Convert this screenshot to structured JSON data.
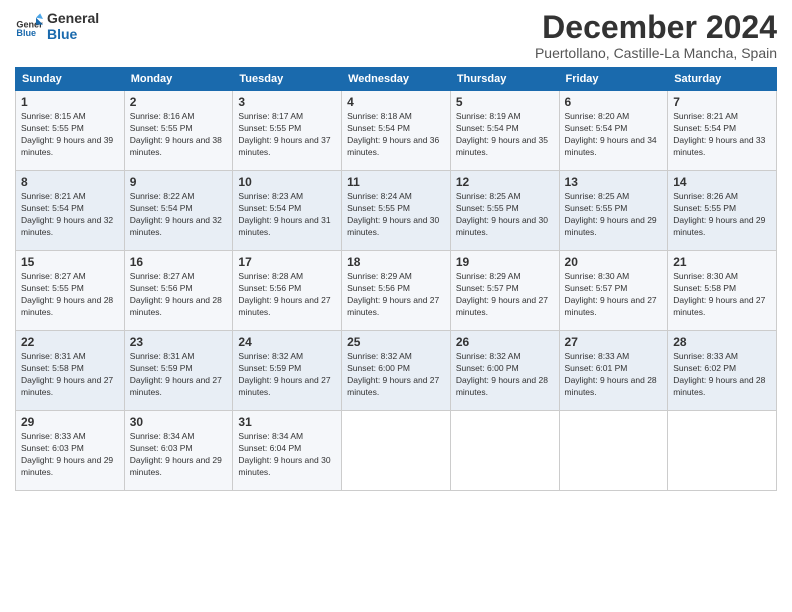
{
  "header": {
    "logo": {
      "general": "General",
      "blue": "Blue"
    },
    "title": "December 2024",
    "location": "Puertollano, Castille-La Mancha, Spain"
  },
  "calendar": {
    "days_of_week": [
      "Sunday",
      "Monday",
      "Tuesday",
      "Wednesday",
      "Thursday",
      "Friday",
      "Saturday"
    ],
    "weeks": [
      [
        null,
        null,
        null,
        null,
        null,
        null,
        null
      ]
    ],
    "cells": [
      {
        "day": 1,
        "sunrise": "8:15 AM",
        "sunset": "5:55 PM",
        "daylight": "9 hours and 39 minutes."
      },
      {
        "day": 2,
        "sunrise": "8:16 AM",
        "sunset": "5:55 PM",
        "daylight": "9 hours and 38 minutes."
      },
      {
        "day": 3,
        "sunrise": "8:17 AM",
        "sunset": "5:55 PM",
        "daylight": "9 hours and 37 minutes."
      },
      {
        "day": 4,
        "sunrise": "8:18 AM",
        "sunset": "5:54 PM",
        "daylight": "9 hours and 36 minutes."
      },
      {
        "day": 5,
        "sunrise": "8:19 AM",
        "sunset": "5:54 PM",
        "daylight": "9 hours and 35 minutes."
      },
      {
        "day": 6,
        "sunrise": "8:20 AM",
        "sunset": "5:54 PM",
        "daylight": "9 hours and 34 minutes."
      },
      {
        "day": 7,
        "sunrise": "8:21 AM",
        "sunset": "5:54 PM",
        "daylight": "9 hours and 33 minutes."
      },
      {
        "day": 8,
        "sunrise": "8:21 AM",
        "sunset": "5:54 PM",
        "daylight": "9 hours and 32 minutes."
      },
      {
        "day": 9,
        "sunrise": "8:22 AM",
        "sunset": "5:54 PM",
        "daylight": "9 hours and 32 minutes."
      },
      {
        "day": 10,
        "sunrise": "8:23 AM",
        "sunset": "5:54 PM",
        "daylight": "9 hours and 31 minutes."
      },
      {
        "day": 11,
        "sunrise": "8:24 AM",
        "sunset": "5:55 PM",
        "daylight": "9 hours and 30 minutes."
      },
      {
        "day": 12,
        "sunrise": "8:25 AM",
        "sunset": "5:55 PM",
        "daylight": "9 hours and 30 minutes."
      },
      {
        "day": 13,
        "sunrise": "8:25 AM",
        "sunset": "5:55 PM",
        "daylight": "9 hours and 29 minutes."
      },
      {
        "day": 14,
        "sunrise": "8:26 AM",
        "sunset": "5:55 PM",
        "daylight": "9 hours and 29 minutes."
      },
      {
        "day": 15,
        "sunrise": "8:27 AM",
        "sunset": "5:55 PM",
        "daylight": "9 hours and 28 minutes."
      },
      {
        "day": 16,
        "sunrise": "8:27 AM",
        "sunset": "5:56 PM",
        "daylight": "9 hours and 28 minutes."
      },
      {
        "day": 17,
        "sunrise": "8:28 AM",
        "sunset": "5:56 PM",
        "daylight": "9 hours and 27 minutes."
      },
      {
        "day": 18,
        "sunrise": "8:29 AM",
        "sunset": "5:56 PM",
        "daylight": "9 hours and 27 minutes."
      },
      {
        "day": 19,
        "sunrise": "8:29 AM",
        "sunset": "5:57 PM",
        "daylight": "9 hours and 27 minutes."
      },
      {
        "day": 20,
        "sunrise": "8:30 AM",
        "sunset": "5:57 PM",
        "daylight": "9 hours and 27 minutes."
      },
      {
        "day": 21,
        "sunrise": "8:30 AM",
        "sunset": "5:58 PM",
        "daylight": "9 hours and 27 minutes."
      },
      {
        "day": 22,
        "sunrise": "8:31 AM",
        "sunset": "5:58 PM",
        "daylight": "9 hours and 27 minutes."
      },
      {
        "day": 23,
        "sunrise": "8:31 AM",
        "sunset": "5:59 PM",
        "daylight": "9 hours and 27 minutes."
      },
      {
        "day": 24,
        "sunrise": "8:32 AM",
        "sunset": "5:59 PM",
        "daylight": "9 hours and 27 minutes."
      },
      {
        "day": 25,
        "sunrise": "8:32 AM",
        "sunset": "6:00 PM",
        "daylight": "9 hours and 27 minutes."
      },
      {
        "day": 26,
        "sunrise": "8:32 AM",
        "sunset": "6:00 PM",
        "daylight": "9 hours and 28 minutes."
      },
      {
        "day": 27,
        "sunrise": "8:33 AM",
        "sunset": "6:01 PM",
        "daylight": "9 hours and 28 minutes."
      },
      {
        "day": 28,
        "sunrise": "8:33 AM",
        "sunset": "6:02 PM",
        "daylight": "9 hours and 28 minutes."
      },
      {
        "day": 29,
        "sunrise": "8:33 AM",
        "sunset": "6:03 PM",
        "daylight": "9 hours and 29 minutes."
      },
      {
        "day": 30,
        "sunrise": "8:34 AM",
        "sunset": "6:03 PM",
        "daylight": "9 hours and 29 minutes."
      },
      {
        "day": 31,
        "sunrise": "8:34 AM",
        "sunset": "6:04 PM",
        "daylight": "9 hours and 30 minutes."
      }
    ]
  }
}
